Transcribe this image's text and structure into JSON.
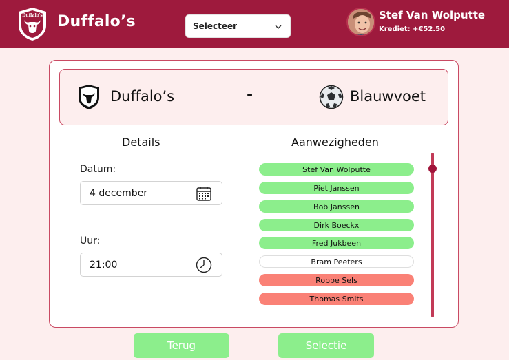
{
  "header": {
    "logo_text": "Duffalo's",
    "brand": "Duffalo’s",
    "team_select": {
      "selected": "Selecteer"
    },
    "user": {
      "name": "Stef Van Wolputte",
      "credit": "Krediet: +€52.50"
    },
    "color": "#9e1a3d"
  },
  "match": {
    "home": "Duffalo’s",
    "separator": "-",
    "away": "Blauwvoet"
  },
  "details": {
    "title": "Details",
    "date_label": "Datum:",
    "date_value": "4 december",
    "time_label": "Uur:",
    "time_value": "21:00"
  },
  "attendance": {
    "title": "Aanwezigheden",
    "players": [
      {
        "name": "Stef Van Wolputte",
        "status": "present"
      },
      {
        "name": "Piet Janssen",
        "status": "present"
      },
      {
        "name": "Bob Janssen",
        "status": "present"
      },
      {
        "name": "Dirk Boeckx",
        "status": "present"
      },
      {
        "name": "Fred Jukbeen",
        "status": "present"
      },
      {
        "name": "Bram Peeters",
        "status": "unknown"
      },
      {
        "name": "Robbe Sels",
        "status": "absent"
      },
      {
        "name": "Thomas Smits",
        "status": "absent"
      }
    ],
    "status_colors": {
      "present": "#8cee8c",
      "unknown": "#ffffff",
      "absent": "#fa8176"
    }
  },
  "buttons": {
    "back": "Terug",
    "selection": "Selectie"
  }
}
